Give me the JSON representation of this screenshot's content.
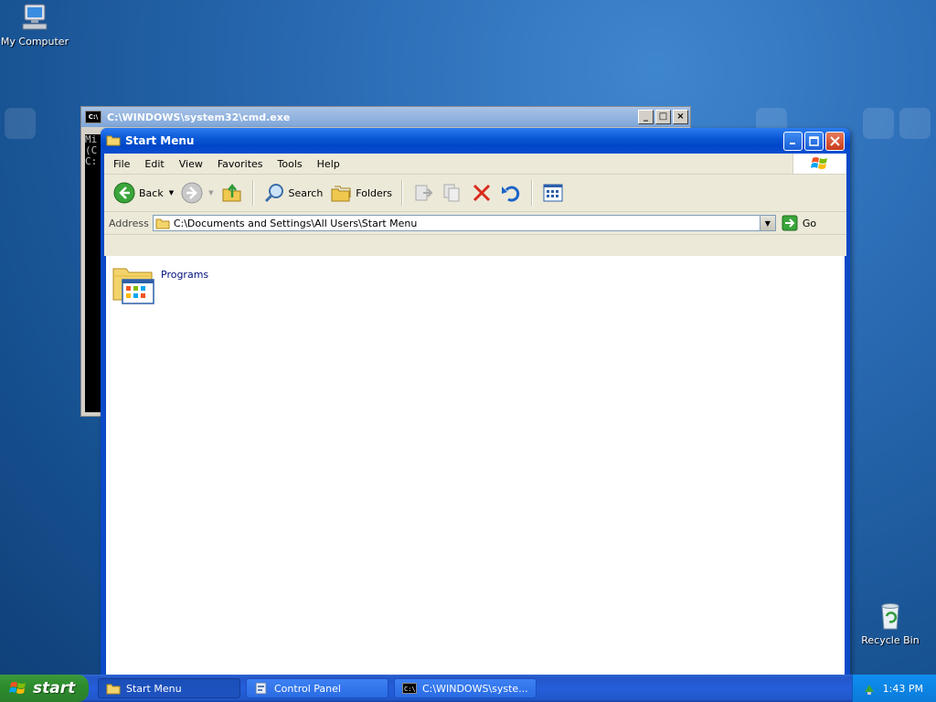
{
  "desktop": {
    "icons": [
      {
        "label": "My Computer"
      },
      {
        "label": "Recycle Bin"
      }
    ]
  },
  "cmd_window": {
    "title": "C:\\WINDOWS\\system32\\cmd.exe",
    "lines": [
      "Mi",
      "(C",
      "",
      "C:"
    ]
  },
  "explorer": {
    "title": "Start Menu",
    "menu": [
      "File",
      "Edit",
      "View",
      "Favorites",
      "Tools",
      "Help"
    ],
    "toolbar": {
      "back": "Back",
      "search": "Search",
      "folders": "Folders"
    },
    "address": {
      "label": "Address",
      "value": "C:\\Documents and Settings\\All Users\\Start Menu",
      "go": "Go"
    },
    "items": [
      {
        "label": "Programs"
      }
    ]
  },
  "taskbar": {
    "start": "start",
    "tasks": [
      {
        "label": "Start Menu",
        "active": true
      },
      {
        "label": "Control Panel",
        "active": false
      },
      {
        "label": "C:\\WINDOWS\\syste...",
        "active": false
      }
    ],
    "clock": "1:43 PM"
  }
}
